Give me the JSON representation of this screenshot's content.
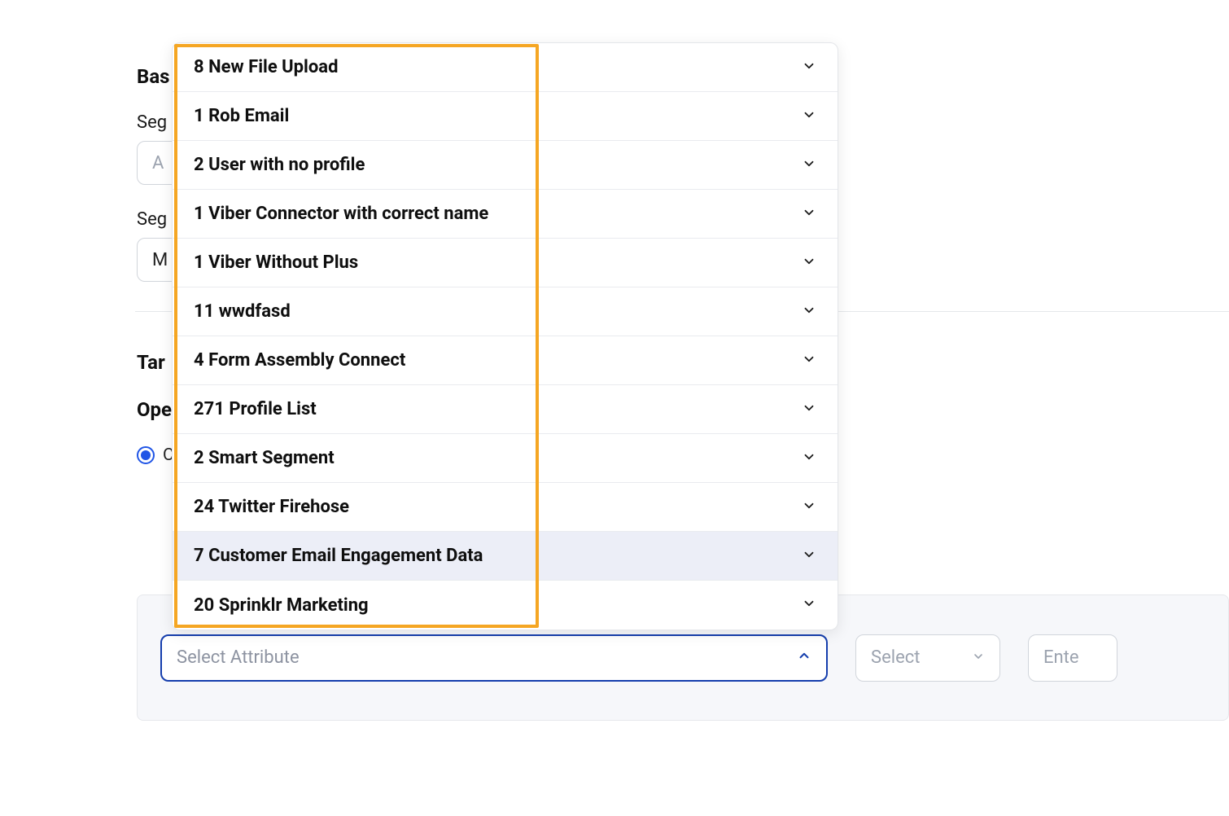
{
  "form": {
    "section1_title": "Bas",
    "label_seg1": "Seg",
    "label_seg2": "Seg",
    "input1_placeholder": "A",
    "input2_value": "M",
    "section2_title": "Tar",
    "section3_title": "Ope",
    "radio_label": "C"
  },
  "dropdown": {
    "items": [
      {
        "label": "8 New File Upload"
      },
      {
        "label": "1 Rob Email"
      },
      {
        "label": "2 User with no profile"
      },
      {
        "label": "1 Viber Connector with correct name"
      },
      {
        "label": "1 Viber Without Plus"
      },
      {
        "label": "11 wwdfasd"
      },
      {
        "label": "4 Form Assembly Connect"
      },
      {
        "label": "271 Profile List"
      },
      {
        "label": "2 Smart Segment"
      },
      {
        "label": "24 Twitter Firehose"
      },
      {
        "label": "7 Customer Email Engagement Data",
        "highlight": true
      },
      {
        "label": "20 Sprinklr Marketing"
      }
    ]
  },
  "bottom": {
    "select_attribute_placeholder": "Select Attribute",
    "select_placeholder": "Select",
    "enter_placeholder": "Ente"
  },
  "colors": {
    "accent_blue": "#153ead",
    "highlight_orange": "#f5a623",
    "item_highlight": "#eceef7"
  }
}
